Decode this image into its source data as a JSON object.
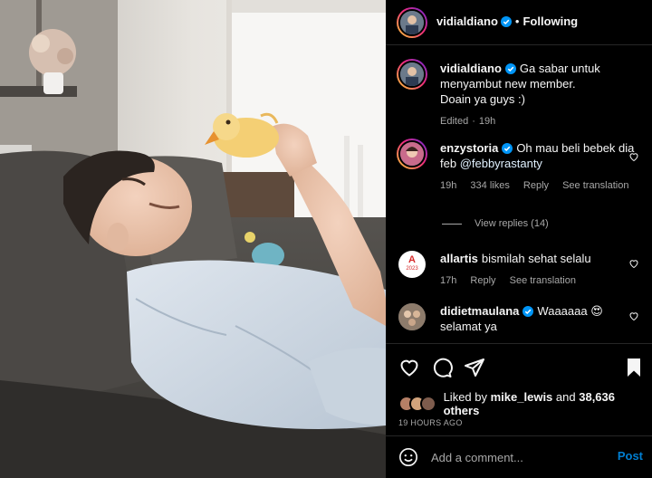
{
  "post": {
    "author": "vidialdiano",
    "follow_label": "Following",
    "separator": "•"
  },
  "caption": {
    "author": "vidialdiano",
    "text_line1": "Ga sabar untuk",
    "text_line2": "menyambut new member.",
    "text_line3": "Doain ya guys :)",
    "edited": "Edited",
    "time": "19h",
    "meta_sep": "·"
  },
  "comments": [
    {
      "author": "enzystoria",
      "text_line1": "Oh mau beli bebek dia",
      "text_line2_prefix": "feb ",
      "mention": "@febbyrastanty",
      "time": "19h",
      "likes": "334 likes",
      "reply": "Reply",
      "translation": "See translation"
    },
    {
      "author": "allartis",
      "text_line1": "bismilah sehat selalu",
      "time": "17h",
      "reply": "Reply",
      "translation": "See translation",
      "avatar_letter": "A",
      "avatar_year": "2023"
    },
    {
      "author": "didietmaulana",
      "text_line1": "Waaaaaa 😍",
      "text_line2": "selamat ya"
    }
  ],
  "view_replies": "View replies (14)",
  "likes": {
    "prefix": "Liked by",
    "user": "mike_lewis",
    "and": "and",
    "others": "38,636 others"
  },
  "time_ago": "19 HOURS AGO",
  "composer": {
    "placeholder": "Add a comment...",
    "post_label": "Post"
  },
  "colors": {
    "background": "#000000",
    "verified": "#0095f6",
    "post_button": "#0095f6",
    "muted_text": "#a8a8a8"
  },
  "icons": [
    "verified-badge-icon",
    "heart-icon",
    "comment-icon",
    "share-icon",
    "bookmark-icon",
    "emoji-icon"
  ]
}
